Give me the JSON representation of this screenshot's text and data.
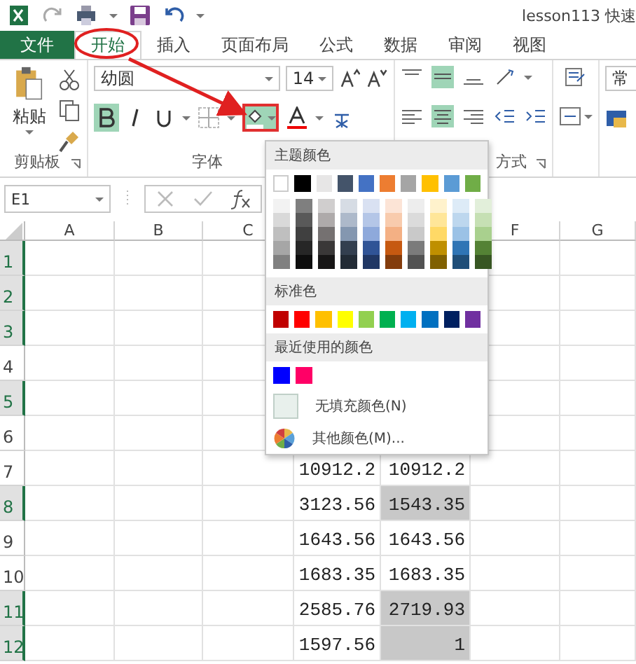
{
  "title_bar": {
    "title": "lesson113 快速"
  },
  "tabs": [
    {
      "label": "文件",
      "kind": "file",
      "selected": false
    },
    {
      "label": "开始",
      "kind": "tab",
      "selected": true
    },
    {
      "label": "插入",
      "kind": "tab",
      "selected": false
    },
    {
      "label": "页面布局",
      "kind": "tab",
      "selected": false
    },
    {
      "label": "公式",
      "kind": "tab",
      "selected": false
    },
    {
      "label": "数据",
      "kind": "tab",
      "selected": false
    },
    {
      "label": "审阅",
      "kind": "tab",
      "selected": false
    },
    {
      "label": "视图",
      "kind": "tab",
      "selected": false
    }
  ],
  "ribbon": {
    "clipboard": {
      "paste": "粘贴",
      "label": "剪贴板"
    },
    "font": {
      "name": "幼圆",
      "size": "14",
      "label": "字体",
      "bold": true,
      "italic": false
    },
    "alignment": {
      "label": "方式"
    },
    "number": {
      "format": "常"
    }
  },
  "formula_bar": {
    "name_box": "E1"
  },
  "columns": [
    "A",
    "B",
    "C",
    null,
    null,
    "F",
    "G"
  ],
  "rows": [
    {
      "label": "1",
      "selected": true
    },
    {
      "label": "2",
      "selected": true
    },
    {
      "label": "3",
      "selected": true
    },
    {
      "label": "4",
      "selected": false
    },
    {
      "label": "5",
      "selected": true
    },
    {
      "label": "6",
      "selected": false
    },
    {
      "label": "7",
      "selected": false,
      "cells": [
        {
          "text": "10912.2",
          "shaded": false
        },
        {
          "text": "10912.2",
          "shaded": false
        }
      ]
    },
    {
      "label": "8",
      "selected": true,
      "cells": [
        {
          "text": "3123.56",
          "shaded": false
        },
        {
          "text": "1543.35",
          "shaded": true
        }
      ]
    },
    {
      "label": "9",
      "selected": false,
      "cells": [
        {
          "text": "1643.56",
          "shaded": false
        },
        {
          "text": "1643.56",
          "shaded": false
        }
      ]
    },
    {
      "label": "10",
      "selected": false,
      "cells": [
        {
          "text": "1683.35",
          "shaded": false
        },
        {
          "text": "1683.35",
          "shaded": false
        }
      ]
    },
    {
      "label": "11",
      "selected": true,
      "cells": [
        {
          "text": "2585.76",
          "shaded": false
        },
        {
          "text": "2719.93",
          "shaded": true
        }
      ]
    },
    {
      "label": "12",
      "selected": true,
      "cells": [
        {
          "text": "1597.56",
          "shaded": false
        },
        {
          "text": "1",
          "shaded": true
        }
      ]
    }
  ],
  "fill_menu": {
    "theme_heading": "主题颜色",
    "theme_colors": [
      {
        "color": "#ffffff",
        "shades": [
          {
            "color": "#f2f2f2"
          },
          {
            "color": "#d9d9d9"
          },
          {
            "color": "#bfbfbf"
          },
          {
            "color": "#a6a6a6"
          },
          {
            "color": "#808080"
          }
        ]
      },
      {
        "color": "#000000",
        "shades": [
          {
            "color": "#7f7f7f"
          },
          {
            "color": "#595959"
          },
          {
            "color": "#404040"
          },
          {
            "color": "#262626"
          },
          {
            "color": "#0d0d0d"
          }
        ]
      },
      {
        "color": "#e7e6e6",
        "shades": [
          {
            "color": "#d0cece"
          },
          {
            "color": "#aeaaaa"
          },
          {
            "color": "#757171"
          },
          {
            "color": "#3a3838"
          },
          {
            "color": "#171616"
          }
        ]
      },
      {
        "color": "#44546a",
        "shades": [
          {
            "color": "#d6dce4"
          },
          {
            "color": "#adb9ca"
          },
          {
            "color": "#8497b0"
          },
          {
            "color": "#333f4f"
          },
          {
            "color": "#222b35"
          }
        ]
      },
      {
        "color": "#4472c4",
        "shades": [
          {
            "color": "#d9e1f2"
          },
          {
            "color": "#b4c6e7"
          },
          {
            "color": "#8ea9db"
          },
          {
            "color": "#305496"
          },
          {
            "color": "#203764"
          }
        ]
      },
      {
        "color": "#ed7d31",
        "shades": [
          {
            "color": "#fce4d6"
          },
          {
            "color": "#f8cbad"
          },
          {
            "color": "#f4b084"
          },
          {
            "color": "#c65911"
          },
          {
            "color": "#833c0c"
          }
        ]
      },
      {
        "color": "#a5a5a5",
        "shades": [
          {
            "color": "#ededed"
          },
          {
            "color": "#dbdbdb"
          },
          {
            "color": "#c9c9c9"
          },
          {
            "color": "#7b7b7b"
          },
          {
            "color": "#525252"
          }
        ]
      },
      {
        "color": "#ffc000",
        "shades": [
          {
            "color": "#fff2cc"
          },
          {
            "color": "#ffe699"
          },
          {
            "color": "#ffd966"
          },
          {
            "color": "#bf8f00"
          },
          {
            "color": "#806000"
          }
        ]
      },
      {
        "color": "#5b9bd5",
        "shades": [
          {
            "color": "#ddebf7"
          },
          {
            "color": "#bdd7ee"
          },
          {
            "color": "#9bc2e6"
          },
          {
            "color": "#2f75b5"
          },
          {
            "color": "#1f4e78"
          }
        ]
      },
      {
        "color": "#70ad47",
        "shades": [
          {
            "color": "#e2efda"
          },
          {
            "color": "#c6e0b4"
          },
          {
            "color": "#a9d08e"
          },
          {
            "color": "#548235"
          },
          {
            "color": "#375623"
          }
        ]
      }
    ],
    "standard_heading": "标准色",
    "standard_colors": [
      {
        "color": "#c00000"
      },
      {
        "color": "#ff0000"
      },
      {
        "color": "#ffc000"
      },
      {
        "color": "#ffff00"
      },
      {
        "color": "#92d050"
      },
      {
        "color": "#00b050"
      },
      {
        "color": "#00b0f0"
      },
      {
        "color": "#0070c0"
      },
      {
        "color": "#002060"
      },
      {
        "color": "#7030a0"
      }
    ],
    "recent_heading": "最近使用的颜色",
    "recent_colors": [
      {
        "color": "#0000ff"
      },
      {
        "color": "#ff0066"
      }
    ],
    "no_fill": "无填充颜色(N)",
    "more_colors": "其他颜色(M)..."
  }
}
